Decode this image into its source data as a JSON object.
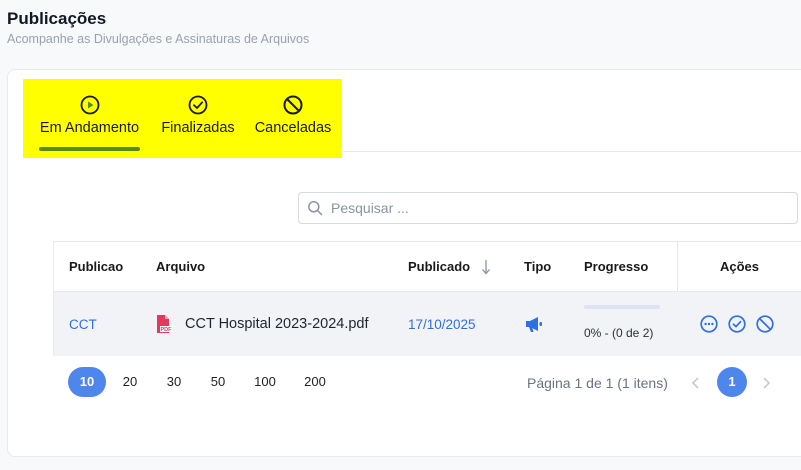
{
  "header": {
    "title": "Publicações",
    "subtitle": "Acompanhe as Divulgações e Assinaturas de Arquivos"
  },
  "tabs": [
    {
      "label": "Em Andamento",
      "icon": "play-circle-icon",
      "active": true
    },
    {
      "label": "Finalizadas",
      "icon": "check-circle-icon",
      "active": false
    },
    {
      "label": "Canceladas",
      "icon": "ban-icon",
      "active": false
    }
  ],
  "search": {
    "placeholder": "Pesquisar ..."
  },
  "table": {
    "columns": [
      "Publicao",
      "Arquivo",
      "Publicado",
      "Tipo",
      "Progresso",
      "Ações"
    ],
    "sort_column": "Publicado",
    "rows": [
      {
        "publicacao": "CCT",
        "arquivo": "CCT Hospital 2023-2024.pdf",
        "arquivo_icon": "pdf-file-icon",
        "publicado": "17/10/2025",
        "tipo_icon": "megaphone-icon",
        "progress_fraction": 0,
        "progresso": "0% - (0 de 2)",
        "actions": [
          "more-icon",
          "check-circle-icon",
          "ban-icon"
        ]
      }
    ]
  },
  "pagination": {
    "page_sizes": [
      "10",
      "20",
      "30",
      "50",
      "100",
      "200"
    ],
    "selected_page_size": "10",
    "info": "Página 1 de 1 (1 itens)",
    "current_page": "1"
  },
  "colors": {
    "accent": "#4f86ec",
    "link": "#2f6fe0",
    "tab_underline": "#5b8a14",
    "tab_icon": "#5b8a14",
    "pdf_icon": "#e8375c",
    "highlight": "#ffff00"
  }
}
